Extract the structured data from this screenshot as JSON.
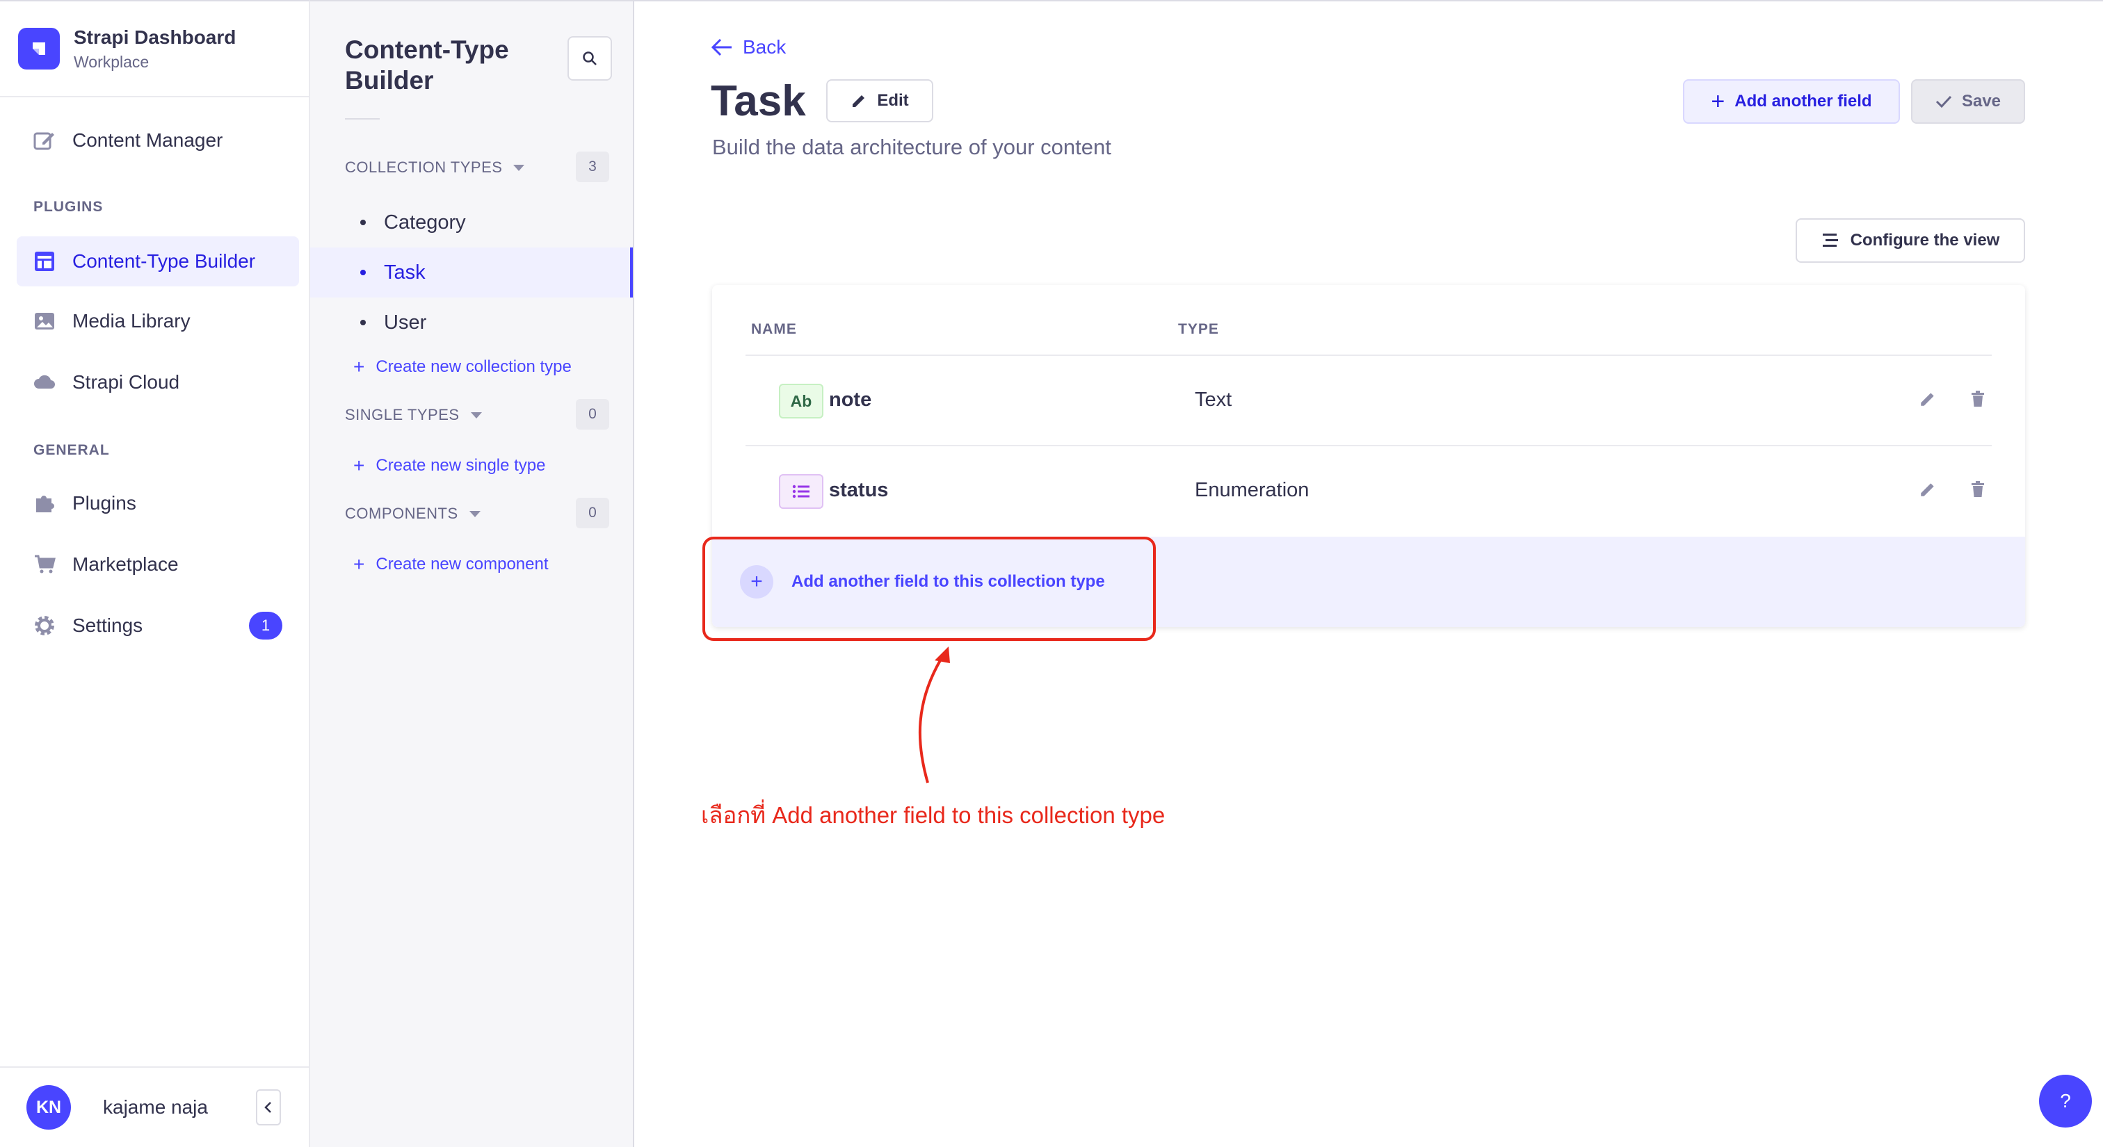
{
  "brand": {
    "title": "Strapi Dashboard",
    "subtitle": "Workplace"
  },
  "mainnav": {
    "content_manager": "Content Manager",
    "plugins_section": "PLUGINS",
    "content_type_builder": "Content-Type Builder",
    "media_library": "Media Library",
    "strapi_cloud": "Strapi Cloud",
    "general_section": "GENERAL",
    "plugins": "Plugins",
    "marketplace": "Marketplace",
    "settings": "Settings",
    "settings_badge": "1"
  },
  "user": {
    "initials": "KN",
    "name": "kajame naja"
  },
  "subnav": {
    "title_line1": "Content-Type",
    "title_line2": "Builder",
    "collection_types": {
      "label": "COLLECTION TYPES",
      "count": "3",
      "items": [
        "Category",
        "Task",
        "User"
      ],
      "create": "Create new collection type"
    },
    "single_types": {
      "label": "SINGLE TYPES",
      "count": "0",
      "create": "Create new single type"
    },
    "components": {
      "label": "COMPONENTS",
      "count": "0",
      "create": "Create new component"
    }
  },
  "main": {
    "back": "Back",
    "title": "Task",
    "edit": "Edit",
    "subtitle": "Build the data architecture of your content",
    "add_another_field": "Add another field",
    "save": "Save",
    "configure_view": "Configure the view"
  },
  "table": {
    "headers": {
      "name": "NAME",
      "type": "TYPE"
    },
    "rows": [
      {
        "badge": "Ab",
        "name": "note",
        "type": "Text"
      },
      {
        "badge": "",
        "name": "status",
        "type": "Enumeration"
      }
    ],
    "add_field_row": "Add another field to this collection type"
  },
  "annotation": {
    "text": "เลือกที่ Add another field to this collection type",
    "color": "#e8281b"
  },
  "help": {
    "label": "?"
  },
  "colors": {
    "primary": "#4945ff",
    "primary_light": "#f0f0ff",
    "text_neutral": "#32324d",
    "text_muted": "#666687"
  }
}
